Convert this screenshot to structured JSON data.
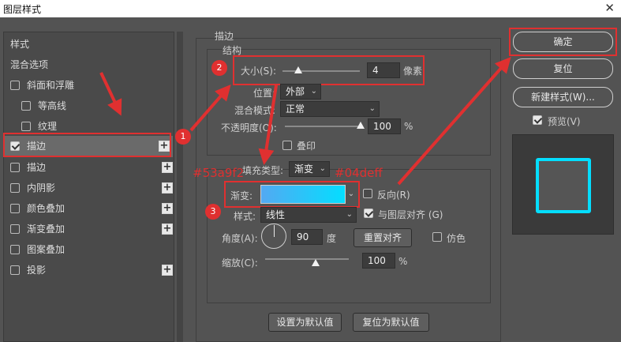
{
  "window": {
    "title": "图层样式",
    "close": "✕"
  },
  "left": {
    "items": [
      {
        "label": "样式"
      },
      {
        "label": "混合选项"
      },
      {
        "label": "斜面和浮雕",
        "checked": false
      },
      {
        "label": "等高线",
        "checked": false
      },
      {
        "label": "纹理",
        "checked": false
      },
      {
        "label": "描边",
        "checked": true,
        "plus": "+"
      },
      {
        "label": "描边",
        "checked": false,
        "plus": "+"
      },
      {
        "label": "内阴影",
        "checked": false,
        "plus": "+"
      },
      {
        "label": "颜色叠加",
        "checked": false,
        "plus": "+"
      },
      {
        "label": "渐变叠加",
        "checked": false,
        "plus": "+"
      },
      {
        "label": "图案叠加",
        "checked": false
      },
      {
        "label": "投影",
        "checked": false,
        "plus": "+"
      }
    ]
  },
  "stroke": {
    "title": "描边",
    "structure": "结构",
    "size_label": "大小(S):",
    "size_value": "4",
    "size_unit": "像素",
    "size_level": 0.05,
    "position_label": "位置:",
    "position_value": "外部",
    "blend_label": "混合模式:",
    "blend_value": "正常",
    "opacity_label": "不透明度(O):",
    "opacity_value": "100",
    "opacity_unit": "%",
    "opacity_level": 1.0,
    "overprint": "叠印",
    "fill_type_label": "填充类型:",
    "fill_type_value": "渐变",
    "gradient_label": "渐变:",
    "gradient_start": "#53a9f2",
    "gradient_end": "#04deff",
    "reverse": "反向(R)",
    "style_label": "样式:",
    "style_value": "线性",
    "align": "与图层对齐 (G)",
    "angle_label": "角度(A):",
    "angle_value": "90",
    "angle_unit": "度",
    "reset_align": "重置对齐",
    "dither": "仿色",
    "scale_label": "缩放(C):",
    "scale_value": "100",
    "scale_unit": "%",
    "scale_level": 0.5,
    "set_default": "设置为默认值",
    "reset_default": "复位为默认值"
  },
  "buttons": {
    "ok": "确定",
    "reset": "复位",
    "new_style": "新建样式(W)...",
    "preview": "预览(V)"
  },
  "annotations": {
    "n1": "1",
    "n2": "2",
    "n3": "3",
    "color1": "#53a9f2",
    "color2": "#04deff"
  },
  "colors": {
    "annotation_red": "#e03030"
  }
}
